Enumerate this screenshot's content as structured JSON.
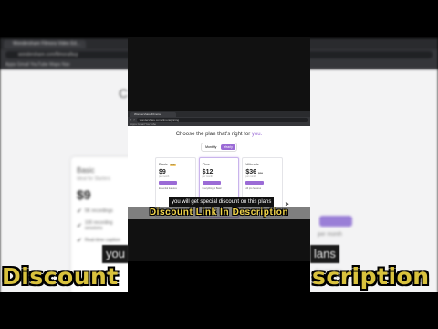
{
  "background_browser": {
    "tab_title": "Wondershare Filmora Video Ed...",
    "url": "wondershare.com/filmora/buy",
    "bookmarks": "Apps   Gmail   YouTube   Maps   Nav",
    "heading": "C",
    "card": {
      "name": "Basic",
      "subtitle": "Ideal for Starters",
      "price": "$9",
      "features": [
        "5K recordings",
        "100 recording sessions",
        "Real-time caption"
      ]
    },
    "right_text": "per month",
    "side_text": "Also includes"
  },
  "inner_page": {
    "tab_title": "Wondershare Filmora",
    "url": "wondershare.com/filmora/pricing",
    "bookmarks": "Apps  Gmail  YouTube",
    "title_prefix": "Choose the plan that's right for ",
    "title_accent": "you.",
    "toggle": {
      "left": "Monthly",
      "right": "Yearly"
    },
    "plans": [
      {
        "name": "Basic",
        "badge": "Best",
        "price": "$9",
        "old_price": "",
        "sub": "per month",
        "feature": "Essential features"
      },
      {
        "name": "Plus",
        "badge": "",
        "price": "$12",
        "old_price": "",
        "sub": "per month",
        "feature": "Everything in Basic"
      },
      {
        "name": "Ultimate",
        "badge": "",
        "price": "$36",
        "old_price": "$59",
        "sub": "per month",
        "feature": "All pro features"
      }
    ]
  },
  "captions": {
    "small": "you will get special discount on this plans",
    "big": "Discount Link In Description",
    "bg_left": "you",
    "bg_right": "lans",
    "banner_left": "Discount",
    "banner_right": "scription"
  },
  "colors": {
    "accent": "#9b6bd6",
    "caption_yellow": "#f2d54a"
  }
}
